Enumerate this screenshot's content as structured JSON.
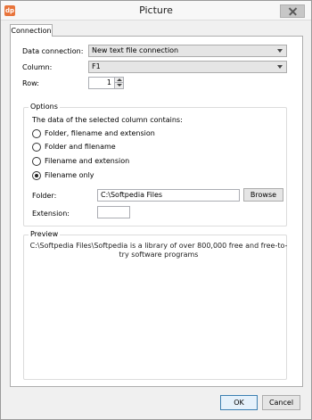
{
  "window": {
    "title": "Picture",
    "app_icon_glyph": "dp"
  },
  "tabs": [
    {
      "label": "Connection"
    }
  ],
  "connection": {
    "data_connection_label": "Data connection:",
    "data_connection_value": "New text file connection",
    "column_label": "Column:",
    "column_value": "F1",
    "row_label": "Row:",
    "row_value": "1"
  },
  "options": {
    "title": "Options",
    "description": "The data of the selected column contains:",
    "radios": [
      {
        "label": "Folder, filename and extension",
        "checked": false
      },
      {
        "label": "Folder and filename",
        "checked": false
      },
      {
        "label": "Filename and extension",
        "checked": false
      },
      {
        "label": "Filename only",
        "checked": true
      }
    ],
    "folder_label": "Folder:",
    "folder_value": "C:\\Softpedia Files",
    "browse_label": "Browse",
    "extension_label": "Extension:",
    "extension_value": ""
  },
  "preview": {
    "title": "Preview",
    "text": "C:\\Softpedia Files\\Softpedia is a library of over 800,000 free and free-to-try software programs"
  },
  "footer": {
    "ok_label": "OK",
    "cancel_label": "Cancel"
  }
}
